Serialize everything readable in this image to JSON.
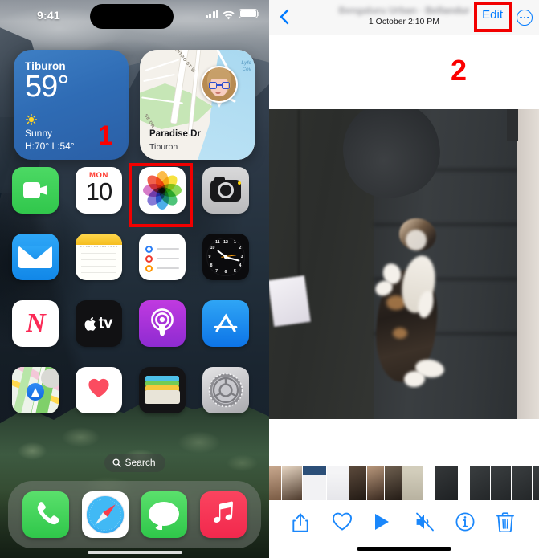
{
  "left_phone": {
    "status_bar": {
      "time": "9:41",
      "cellular_icon": "cellular-signal-icon",
      "wifi_icon": "wifi-icon",
      "battery_icon": "battery-icon"
    },
    "widgets": {
      "weather": {
        "city": "Tiburon",
        "temperature": "59°",
        "condition": "Sunny",
        "high_low": "H:70° L:54°",
        "condition_icon": "sun-icon",
        "accent": "#2f6cb5"
      },
      "maps": {
        "title": "Paradise Dr",
        "subtitle": "Tiburon",
        "street_label_1": "ENTRO ST W",
        "street_label_2": "SE DR",
        "water_label": "Lyfo\nCov",
        "avatar_icon": "memoji-avatar-icon"
      }
    },
    "app_grid": [
      [
        {
          "name": "facetime",
          "label": ""
        },
        {
          "name": "calendar",
          "label": "",
          "dow": "MON",
          "day": "10"
        },
        {
          "name": "photos",
          "label": "",
          "highlighted": true
        },
        {
          "name": "camera",
          "label": ""
        }
      ],
      [
        {
          "name": "mail",
          "label": ""
        },
        {
          "name": "notes",
          "label": ""
        },
        {
          "name": "reminders",
          "label": ""
        },
        {
          "name": "clock",
          "label": ""
        }
      ],
      [
        {
          "name": "news",
          "label": "N"
        },
        {
          "name": "tv",
          "label": "tv"
        },
        {
          "name": "podcasts",
          "label": ""
        },
        {
          "name": "app-store",
          "label": ""
        }
      ],
      [
        {
          "name": "maps",
          "label": ""
        },
        {
          "name": "health",
          "label": ""
        },
        {
          "name": "wallet",
          "label": ""
        },
        {
          "name": "settings",
          "label": ""
        }
      ]
    ],
    "search": {
      "label": "Search",
      "icon": "search-icon"
    },
    "dock": [
      {
        "name": "phone"
      },
      {
        "name": "safari"
      },
      {
        "name": "messages"
      },
      {
        "name": "music"
      }
    ],
    "annotation": {
      "number": "1",
      "color": "#fb0000"
    },
    "highlight_color": "#f20000"
  },
  "right_phone": {
    "header": {
      "back_icon": "back-chevron-icon",
      "title": "Bengaluru Urban · Bellandur",
      "subtitle": "1 October  2:10 PM",
      "edit_label": "Edit",
      "more_icon": "more-options-icon",
      "edit_highlighted": true
    },
    "annotation": {
      "number": "2",
      "color": "#fb0000"
    },
    "photo": {
      "description": "blurry photo of a calico cat lying on a dark grey couch"
    },
    "filmstrip": [
      {
        "name": "thumb-1"
      },
      {
        "name": "thumb-2"
      },
      {
        "name": "thumb-3"
      },
      {
        "name": "thumb-4"
      },
      {
        "name": "thumb-5"
      },
      {
        "name": "thumb-6"
      },
      {
        "name": "thumb-7"
      },
      {
        "name": "thumb-8-selected"
      },
      {
        "name": "thumb-9"
      },
      {
        "name": "thumb-10"
      },
      {
        "name": "thumb-11"
      },
      {
        "name": "thumb-12"
      },
      {
        "name": "thumb-13"
      },
      {
        "name": "thumb-14"
      },
      {
        "name": "thumb-15"
      },
      {
        "name": "thumb-16"
      }
    ],
    "toolbar": [
      {
        "name": "share-icon",
        "label": "Share"
      },
      {
        "name": "favorite-heart-icon",
        "label": "Favorite"
      },
      {
        "name": "play-icon",
        "label": "Play"
      },
      {
        "name": "mute-icon",
        "label": "Mute"
      },
      {
        "name": "info-icon",
        "label": "Info"
      },
      {
        "name": "trash-icon",
        "label": "Delete"
      }
    ],
    "accent_color": "#007aff"
  }
}
